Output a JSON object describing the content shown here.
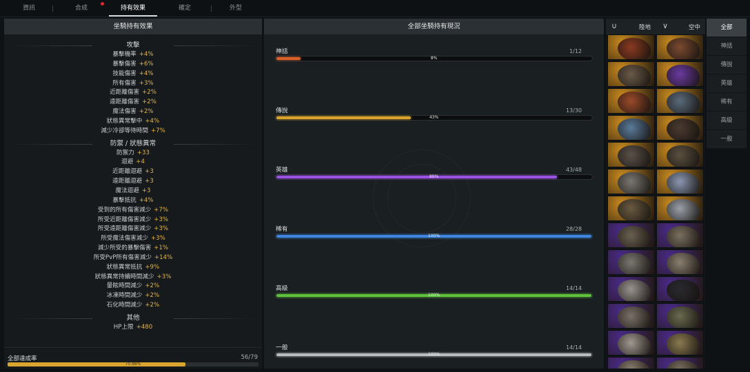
{
  "tabs": [
    {
      "label": "資訊",
      "active": false
    },
    {
      "label": "合成",
      "active": false,
      "alert": true
    },
    {
      "label": "持有效果",
      "active": true
    },
    {
      "label": "確定",
      "active": false
    },
    {
      "label": "外型",
      "active": false
    }
  ],
  "left_panel": {
    "title": "坐騎持有效果",
    "sections": [
      {
        "title": "攻擊",
        "items": [
          {
            "label": "暴擊機率",
            "value": "+4%"
          },
          {
            "label": "暴擊傷害",
            "value": "+6%"
          },
          {
            "label": "技能傷害",
            "value": "+4%"
          },
          {
            "label": "所有傷害",
            "value": "+3%"
          },
          {
            "label": "近距離傷害",
            "value": "+2%"
          },
          {
            "label": "遠距離傷害",
            "value": "+2%"
          },
          {
            "label": "魔法傷害",
            "value": "+2%"
          },
          {
            "label": "狀態異常擊中",
            "value": "+4%"
          },
          {
            "label": "減少冷卻等待時間",
            "value": "+7%"
          }
        ]
      },
      {
        "title": "防禦 / 狀態異常",
        "items": [
          {
            "label": "防禦力",
            "value": "+33"
          },
          {
            "label": "迴避",
            "value": "+4"
          },
          {
            "label": "近距離迴避",
            "value": "+3"
          },
          {
            "label": "遠距離迴避",
            "value": "+3"
          },
          {
            "label": "魔法迴避",
            "value": "+3"
          },
          {
            "label": "暴擊抵抗",
            "value": "+4%"
          },
          {
            "label": "受到的所有傷害減少",
            "value": "+7%"
          },
          {
            "label": "所受近距離傷害減少",
            "value": "+3%"
          },
          {
            "label": "所受遠距離傷害減少",
            "value": "+3%"
          },
          {
            "label": "所受魔法傷害減少",
            "value": "+3%"
          },
          {
            "label": "減少所受的暴擊傷害",
            "value": "+1%"
          },
          {
            "label": "所受PvP所有傷害減少",
            "value": "+14%"
          },
          {
            "label": "狀態異常抵抗",
            "value": "+9%"
          },
          {
            "label": "狀態異常持續時間減少",
            "value": "+3%"
          },
          {
            "label": "暈眩時間減少",
            "value": "+2%"
          },
          {
            "label": "冰凍時間減少",
            "value": "+2%"
          },
          {
            "label": "石化時間減少",
            "value": "+2%"
          }
        ]
      },
      {
        "title": "其他",
        "items": [
          {
            "label": "HP上限",
            "value": "+480"
          }
        ]
      }
    ],
    "footer": {
      "label": "全部達成率",
      "count": "56/79",
      "percent_text": "70.88%",
      "progress": 0.7088
    }
  },
  "mid_panel": {
    "title": "全部坐騎持有現況",
    "grades": [
      {
        "name": "神話",
        "count": "1/12",
        "percent": "8%",
        "progress": 0.08,
        "color": "#d9622a"
      },
      {
        "name": "傳說",
        "count": "13/30",
        "percent": "43%",
        "progress": 0.43,
        "color": "#d9a52e"
      },
      {
        "name": "英雄",
        "count": "43/48",
        "percent": "89%",
        "progress": 0.89,
        "color": "#9a52e0"
      },
      {
        "name": "稀有",
        "count": "28/28",
        "percent": "100%",
        "progress": 1.0,
        "color": "#3f86e0"
      },
      {
        "name": "高級",
        "count": "14/14",
        "percent": "100%",
        "progress": 1.0,
        "color": "#5fc23c"
      },
      {
        "name": "一般",
        "count": "14/14",
        "percent": "100%",
        "progress": 1.0,
        "color": "#b9bcbf"
      }
    ]
  },
  "thumb_header": {
    "ground_icon": "horseshoe-icon",
    "ground_label": "陸地",
    "air_icon": "wing-icon",
    "air_label": "空中"
  },
  "thumb_rows": [
    {
      "bg": "#c98a1e",
      "tint": [
        "#8a3a20",
        "#7a4a30"
      ]
    },
    {
      "bg": "#c98a1e",
      "tint": [
        "#6a5a48",
        "#6a3aa0"
      ]
    },
    {
      "bg": "#c98a1e",
      "tint": [
        "#9a4a2a",
        "#5a6a7a"
      ]
    },
    {
      "bg": "#c98a1e",
      "tint": [
        "#5a7a9a",
        "#4a3a30"
      ]
    },
    {
      "bg": "#c98a1e",
      "tint": [
        "#5a5048",
        "#5a5040"
      ]
    },
    {
      "bg": "#c98a1e",
      "tint": [
        "#7a7670",
        "#8a96b0"
      ]
    },
    {
      "bg": "#c98a1e",
      "tint": [
        "#6a5a40",
        "#9aa0a8"
      ]
    },
    {
      "bg": "#4a2a8a",
      "tint": [
        "#6a6050",
        "#7a7060"
      ]
    },
    {
      "bg": "#4a2a8a",
      "tint": [
        "#7a7670",
        "#8a8070"
      ]
    },
    {
      "bg": "#4a2a8a",
      "tint": [
        "#9a9490",
        "#2a2a30"
      ]
    },
    {
      "bg": "#4a2a8a",
      "tint": [
        "#7a7068",
        "#6a6a50"
      ]
    },
    {
      "bg": "#4a2a8a",
      "tint": [
        "#a09890",
        "#8a7a50"
      ]
    },
    {
      "bg": "#4a2a8a",
      "tint": [
        "#8a8070",
        "#7a7060"
      ]
    }
  ],
  "filters": [
    {
      "label": "全部",
      "active": true
    },
    {
      "label": "神話",
      "active": false
    },
    {
      "label": "傳說",
      "active": false
    },
    {
      "label": "英雄",
      "active": false
    },
    {
      "label": "稀有",
      "active": false
    },
    {
      "label": "高級",
      "active": false
    },
    {
      "label": "一般",
      "active": false
    }
  ]
}
